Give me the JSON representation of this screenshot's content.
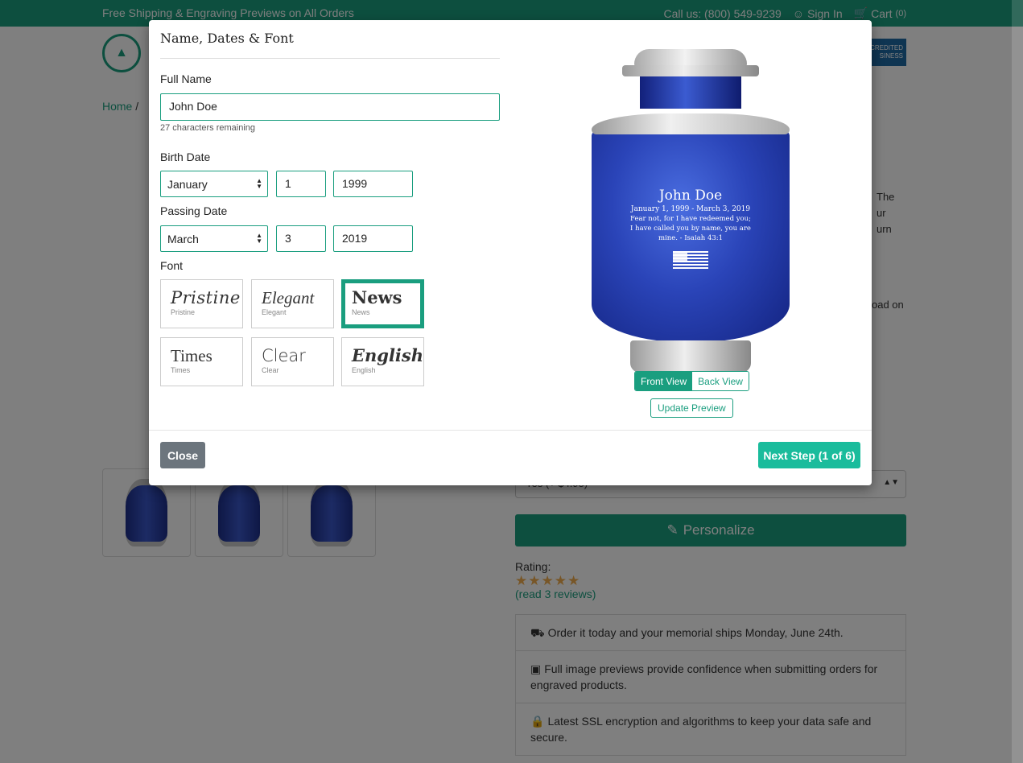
{
  "topbar": {
    "promo": "Free Shipping & Engraving Previews on All Orders",
    "call": "Call us: (800) 549-9239",
    "sign_in": "Sign In",
    "cart": "Cart",
    "cart_count": "(0)"
  },
  "bbb": {
    "line1": "CREDITED",
    "line2": "SINESS"
  },
  "breadcrumb": {
    "home": "Home",
    "sep": "/"
  },
  "background": {
    "fragments": [
      "The",
      "ur",
      "urn",
      "oad on"
    ],
    "select_value": "Yes (+ $4.95)",
    "personalize": "Personalize",
    "rating_label": "Rating:",
    "stars": "★★★★★",
    "reviews": "(read 3 reviews)",
    "info": [
      "Order it today and your memorial ships Monday, June 24th.",
      "Full image previews provide confidence when submitting orders for engraved products.",
      "Latest SSL encryption and algorithms to keep your data safe and secure."
    ]
  },
  "modal": {
    "title": "Name, Dates & Font",
    "full_name_label": "Full Name",
    "full_name_value": "John Doe",
    "chars_remaining": "27 characters remaining",
    "birth_label": "Birth Date",
    "birth": {
      "month": "January",
      "day": "1",
      "year": "1999"
    },
    "passing_label": "Passing Date",
    "passing": {
      "month": "March",
      "day": "3",
      "year": "2019"
    },
    "font_label": "Font",
    "fonts": [
      {
        "sample": "Pristine",
        "name": "Pristine"
      },
      {
        "sample": "Elegant",
        "name": "Elegant"
      },
      {
        "sample": "News",
        "name": "News"
      },
      {
        "sample": "Times",
        "name": "Times"
      },
      {
        "sample": "Clear",
        "name": "Clear"
      },
      {
        "sample": "English",
        "name": "English"
      }
    ],
    "selected_font": "News",
    "preview": {
      "name": "John Doe",
      "dates": "January 1, 1999 - March 3, 2019",
      "verse": "Fear not, for I have redeemed you; I have called you by name, you are mine. - Isaiah 43:1"
    },
    "front_view": "Front View",
    "back_view": "Back View",
    "update_preview": "Update Preview",
    "close": "Close",
    "next_step": "Next Step (1 of 6)"
  },
  "colors": {
    "brand": "#1a9e7f",
    "next": "#1abc9c",
    "close": "#6c757d"
  }
}
